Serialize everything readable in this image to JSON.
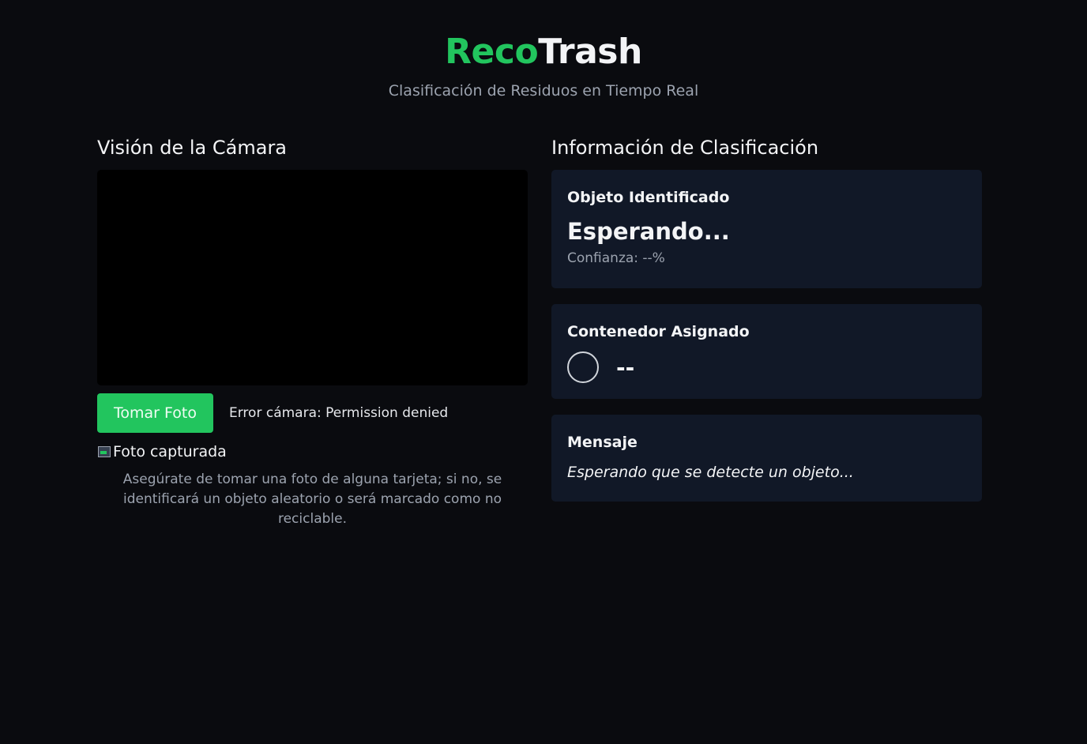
{
  "header": {
    "logo_part1": "Reco",
    "logo_part2": "Trash",
    "subtitle": "Clasificación de Residuos en Tiempo Real"
  },
  "camera": {
    "title": "Visión de la Cámara",
    "capture_button_label": "Tomar Foto",
    "status": "Error cámara: Permission denied",
    "photo_alt": "Foto capturada",
    "hint": "Asegúrate de tomar una foto de alguna tarjeta; si no, se identificará un objeto aleatorio o será marcado como no reciclable."
  },
  "classification": {
    "title": "Información de Clasificación",
    "object_card": {
      "label": "Objeto Identificado",
      "value": "Esperando...",
      "confidence": "Confianza: --%"
    },
    "container_card": {
      "label": "Contenedor Asignado",
      "value": "--"
    },
    "message_card": {
      "label": "Mensaje",
      "value": "Esperando que se detecte un objeto..."
    }
  },
  "colors": {
    "brand": "#22c55e",
    "background": "#0a0b0f",
    "card": "#111827"
  }
}
